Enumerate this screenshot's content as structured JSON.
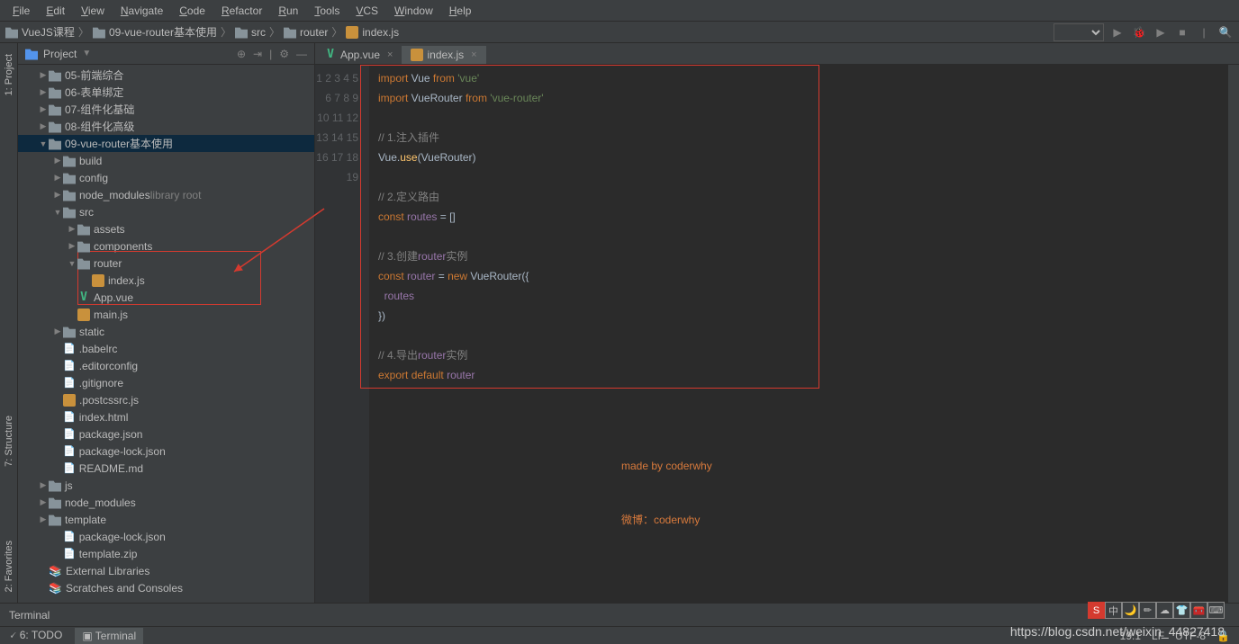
{
  "menu": [
    "File",
    "Edit",
    "View",
    "Navigate",
    "Code",
    "Refactor",
    "Run",
    "Tools",
    "VCS",
    "Window",
    "Help"
  ],
  "breadcrumb": [
    "VueJS课程",
    "09-vue-router基本使用",
    "src",
    "router",
    "index.js"
  ],
  "sidebar_title": "Project",
  "tree": [
    {
      "d": 0,
      "a": "▶",
      "i": "folder",
      "t": "05-前端综合"
    },
    {
      "d": 0,
      "a": "▶",
      "i": "folder",
      "t": "06-表单绑定"
    },
    {
      "d": 0,
      "a": "▶",
      "i": "folder",
      "t": "07-组件化基础"
    },
    {
      "d": 0,
      "a": "▶",
      "i": "folder",
      "t": "08-组件化高级"
    },
    {
      "d": 0,
      "a": "▼",
      "i": "folder",
      "t": "09-vue-router基本使用",
      "sel": true
    },
    {
      "d": 1,
      "a": "▶",
      "i": "folder",
      "t": "build"
    },
    {
      "d": 1,
      "a": "▶",
      "i": "folder",
      "t": "config"
    },
    {
      "d": 1,
      "a": "▶",
      "i": "folder",
      "t": "node_modules",
      "suffix": "library root"
    },
    {
      "d": 1,
      "a": "▼",
      "i": "folder",
      "t": "src"
    },
    {
      "d": 2,
      "a": "▶",
      "i": "folder",
      "t": "assets"
    },
    {
      "d": 2,
      "a": "▶",
      "i": "folder",
      "t": "components"
    },
    {
      "d": 2,
      "a": "▼",
      "i": "folder",
      "t": "router"
    },
    {
      "d": 3,
      "a": "",
      "i": "js",
      "t": "index.js"
    },
    {
      "d": 2,
      "a": "",
      "i": "vue",
      "t": "App.vue"
    },
    {
      "d": 2,
      "a": "",
      "i": "js",
      "t": "main.js"
    },
    {
      "d": 1,
      "a": "▶",
      "i": "folder",
      "t": "static"
    },
    {
      "d": 1,
      "a": "",
      "i": "file",
      "t": ".babelrc"
    },
    {
      "d": 1,
      "a": "",
      "i": "file",
      "t": ".editorconfig"
    },
    {
      "d": 1,
      "a": "",
      "i": "file",
      "t": ".gitignore"
    },
    {
      "d": 1,
      "a": "",
      "i": "js",
      "t": ".postcssrc.js"
    },
    {
      "d": 1,
      "a": "",
      "i": "file",
      "t": "index.html"
    },
    {
      "d": 1,
      "a": "",
      "i": "file",
      "t": "package.json"
    },
    {
      "d": 1,
      "a": "",
      "i": "file",
      "t": "package-lock.json"
    },
    {
      "d": 1,
      "a": "",
      "i": "file",
      "t": "README.md"
    },
    {
      "d": 0,
      "a": "▶",
      "i": "folder",
      "t": "js"
    },
    {
      "d": 0,
      "a": "▶",
      "i": "folder",
      "t": "node_modules"
    },
    {
      "d": 0,
      "a": "▶",
      "i": "folder",
      "t": "template"
    },
    {
      "d": 1,
      "a": "",
      "i": "file",
      "t": "package-lock.json"
    },
    {
      "d": 1,
      "a": "",
      "i": "file",
      "t": "template.zip"
    },
    {
      "d": 0,
      "a": "",
      "i": "lib",
      "t": "External Libraries"
    },
    {
      "d": 0,
      "a": "",
      "i": "lib",
      "t": "Scratches and Consoles"
    }
  ],
  "tabs": [
    {
      "icon": "vue",
      "label": "App.vue",
      "active": false
    },
    {
      "icon": "js",
      "label": "index.js",
      "active": true
    }
  ],
  "code_plain": "import Vue from 'vue'\nimport VueRouter from 'vue-router'\n\n// 1.注入插件\nVue.use(VueRouter)\n\n// 2.定义路由\nconst routes = []\n\n// 3.创建router实例\nconst router = new VueRouter({\n  routes\n})\n\n// 4.导出router实例\nexport default router\n\n\n",
  "watermark": [
    "made by coderwhy",
    "微博：coderwhy"
  ],
  "terminal_label": "Terminal",
  "bottom_tabs": [
    "6: TODO",
    "Terminal"
  ],
  "status": {
    "pos": "19:1",
    "le": "LF",
    "enc": "UTF-8"
  },
  "url": "https://blog.csdn.net/weixin_44827418",
  "left_tabs": [
    "1: Project",
    "7: Structure",
    "2: Favorites"
  ]
}
